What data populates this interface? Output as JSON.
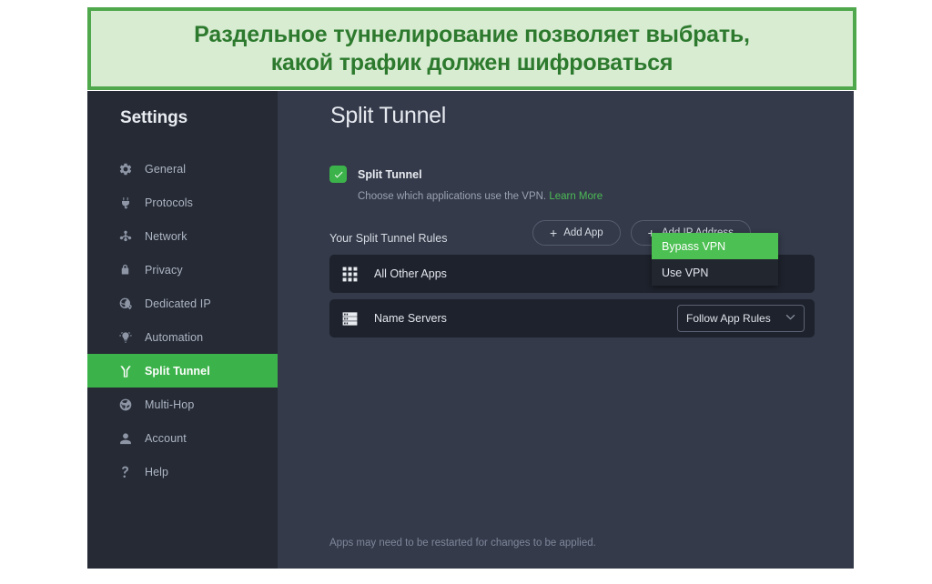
{
  "banner": {
    "line1": "Раздельное туннелирование позволяет выбрать,",
    "line2": "какой трафик должен шифроваться",
    "text_color": "#2d7a2e",
    "bg_color": "#d8ecd2",
    "border_color": "#4fa84c"
  },
  "sidebar": {
    "title": "Settings",
    "items": [
      {
        "label": "General",
        "icon": "gear-icon"
      },
      {
        "label": "Protocols",
        "icon": "plug-icon"
      },
      {
        "label": "Network",
        "icon": "network-nodes-icon"
      },
      {
        "label": "Privacy",
        "icon": "lock-icon"
      },
      {
        "label": "Dedicated IP",
        "icon": "globe-pin-icon"
      },
      {
        "label": "Automation",
        "icon": "lightbulb-icon"
      },
      {
        "label": "Split Tunnel",
        "icon": "split-tunnel-icon",
        "active": true
      },
      {
        "label": "Multi-Hop",
        "icon": "globe-arrow-icon"
      },
      {
        "label": "Account",
        "icon": "person-icon"
      },
      {
        "label": "Help",
        "icon": "question-mark-icon"
      }
    ],
    "active_color": "#3cb34a",
    "bg_color": "#252a35"
  },
  "main": {
    "page_title": "Split Tunnel",
    "toggle": {
      "label": "Split Tunnel",
      "checked": true,
      "description": "Choose which applications use the VPN.",
      "learn_more": "Learn More"
    },
    "rules_title": "Your Split Tunnel Rules",
    "buttons": [
      {
        "label": "Add App",
        "icon": "plus-icon"
      },
      {
        "label": "Add IP Address",
        "icon": "plus-icon"
      }
    ],
    "rules": [
      {
        "label": "All Other Apps",
        "icon": "apps-grid-icon",
        "value": "Bypass VPN"
      },
      {
        "label": "Name Servers",
        "icon": "server-rack-icon",
        "value": "Follow App Rules"
      }
    ],
    "dropdown": {
      "open": true,
      "options": [
        "Bypass VPN",
        "Use VPN"
      ],
      "selected": "Bypass VPN",
      "highlight_color": "#4cc052",
      "bg_color": "#22262f"
    },
    "footnote": "Apps may need to be restarted for changes to be applied."
  }
}
